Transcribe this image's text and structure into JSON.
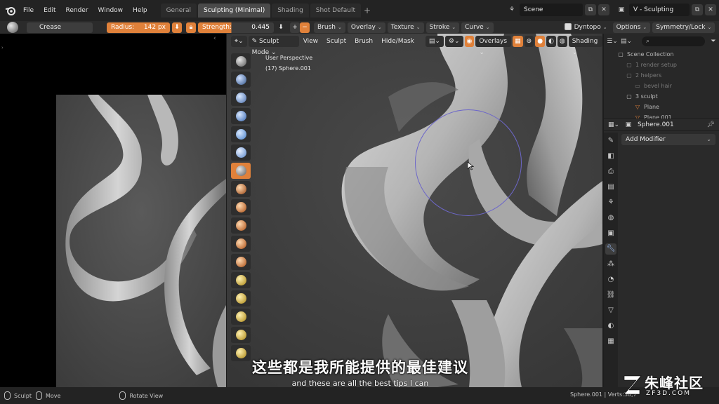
{
  "topbar": {
    "menus": [
      "File",
      "Edit",
      "Render",
      "Window",
      "Help"
    ],
    "workspace_tabs": [
      "General",
      "Sculpting (Minimal)",
      "Shading",
      "Shot Default"
    ],
    "active_tab": "Sculpting (Minimal)",
    "scene_label": "Scene",
    "view_layer_label": "V - Sculpting"
  },
  "toolbar": {
    "brush_name": "Crease",
    "radius_label": "Radius:",
    "radius_value": "142 px",
    "strength_label": "Strength:",
    "strength_value": "0.445",
    "menus": [
      "Brush",
      "Overlay",
      "Texture",
      "Stroke",
      "Curve"
    ],
    "dyntopo_label": "Dyntopo",
    "options_label": "Options",
    "symmetry_label": "Symmetry/Lock"
  },
  "viewport": {
    "mode_label": "Sculpt Mode",
    "menus": [
      "View",
      "Sculpt",
      "Brush",
      "Hide/Mask"
    ],
    "overlays_label": "Overlays",
    "shading_label": "Shading",
    "info_line1": "User Perspective",
    "info_line2": "(17) Sphere.001"
  },
  "subtitles": {
    "chinese": "这些都是我所能提供的最佳建议",
    "english": "and these are all the best tips I can"
  },
  "outliner": {
    "rows": [
      {
        "label": "Scene Collection",
        "icon": "collection-icon",
        "indent": 0,
        "dim": false
      },
      {
        "label": "1 render setup",
        "icon": "collection-icon",
        "indent": 1,
        "dim": true
      },
      {
        "label": "2 helpers",
        "icon": "collection-icon",
        "indent": 1,
        "dim": true
      },
      {
        "label": "bevel hair",
        "icon": "object-icon",
        "indent": 2,
        "dim": true
      },
      {
        "label": "3 sculpt",
        "icon": "collection-icon",
        "indent": 1,
        "dim": false
      },
      {
        "label": "Plane",
        "icon": "mesh-icon",
        "indent": 2,
        "dim": false
      },
      {
        "label": "Plane.001",
        "icon": "mesh-icon",
        "indent": 2,
        "dim": false
      }
    ]
  },
  "properties": {
    "object_name": "Sphere.001",
    "add_modifier_label": "Add Modifier",
    "tabs": [
      "tool-icon",
      "render-icon",
      "output-icon",
      "view-layer-icon",
      "scene-icon",
      "world-icon",
      "object-icon",
      "modifier-icon",
      "particles-icon",
      "physics-icon",
      "constraints-icon",
      "data-icon",
      "material-icon",
      "texture-icon"
    ]
  },
  "statusbar": {
    "sculpt_label": "Sculpt",
    "move_label": "Move",
    "rotate_label": "Rotate View",
    "stats": "Sphere.001 | Verts:38,7"
  },
  "watermark": {
    "title": "朱峰社区",
    "url": "ZF3D.COM"
  },
  "colors": {
    "accent_orange": "#e0813a",
    "brush_circle": "#6d67c9"
  }
}
